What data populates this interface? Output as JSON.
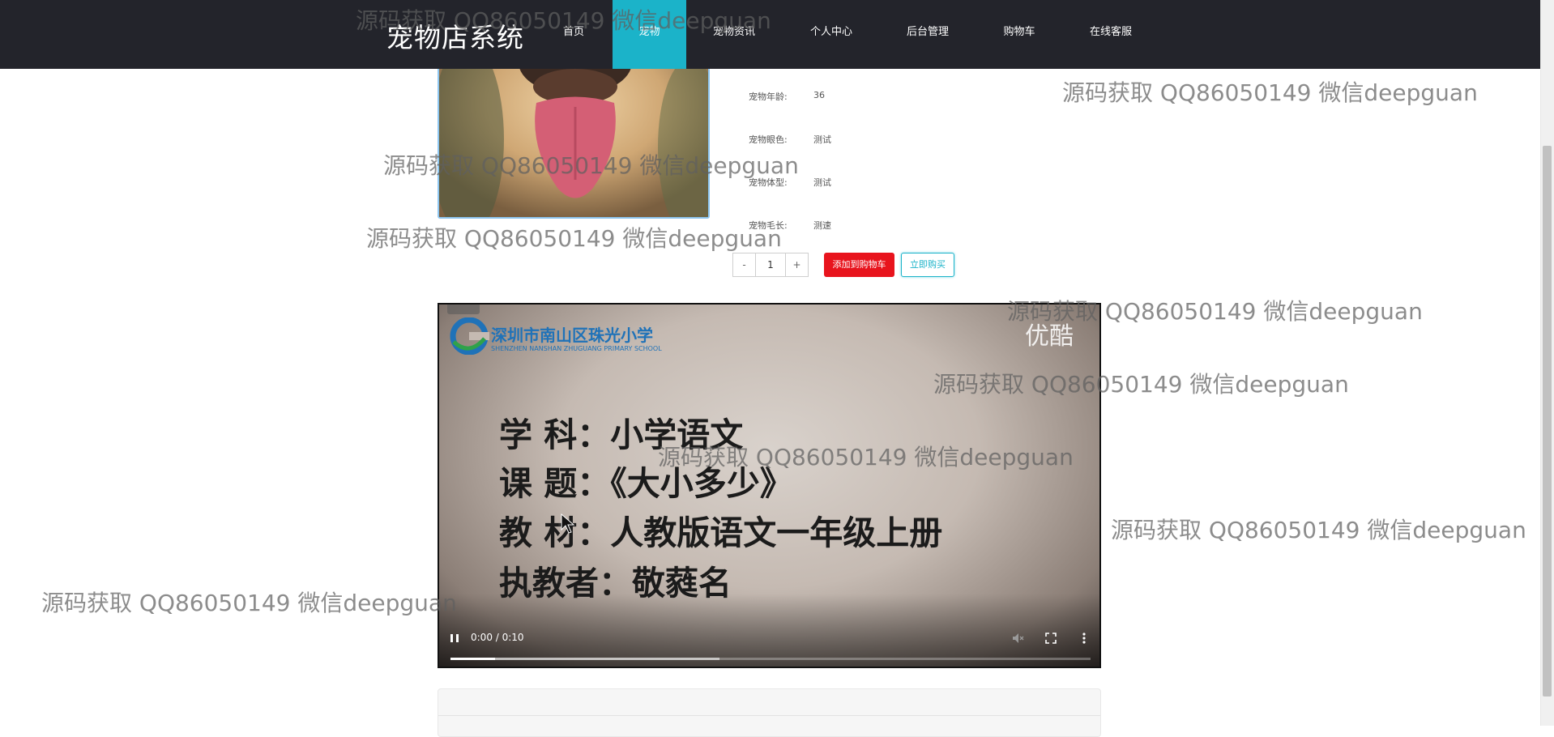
{
  "header": {
    "brand": "宠物店系统",
    "nav": [
      {
        "label": "首页",
        "active": false
      },
      {
        "label": "宠物",
        "active": true
      },
      {
        "label": "宠物资讯",
        "active": false
      },
      {
        "label": "个人中心",
        "active": false
      },
      {
        "label": "后台管理",
        "active": false
      },
      {
        "label": "购物车",
        "active": false
      },
      {
        "label": "在线客服",
        "active": false
      }
    ],
    "active_color": "#1bb3c9",
    "bg_color": "#23242b"
  },
  "product": {
    "attributes": [
      {
        "label": "宠物年龄:",
        "value": "36"
      },
      {
        "label": "宠物眼色:",
        "value": "测试"
      },
      {
        "label": "宠物体型:",
        "value": "测试"
      },
      {
        "label": "宠物毛长:",
        "value": "测速"
      }
    ],
    "quantity": {
      "minus": "-",
      "value": "1",
      "plus": "+"
    },
    "add_to_cart": "添加到购物车",
    "buy_now": "立即购买",
    "cart_color": "#e8141d"
  },
  "video": {
    "school_name": "深圳市南山区珠光小学",
    "school_name_en": "SHENZHEN NANSHAN ZHUGUANG PRIMARY SCHOOL",
    "watermark_logo": "优酷",
    "lines": [
      "学    科：小学语文",
      "课    题：《大小多少》",
      "教    材：人教版语文一年级上册",
      "执教者：敬蕤名"
    ],
    "time": "0:00 / 0:10",
    "played_fraction": 0.07,
    "buffered_fraction": 0.42
  },
  "watermark_text": "源码获取 QQ86050149 微信deepguan"
}
